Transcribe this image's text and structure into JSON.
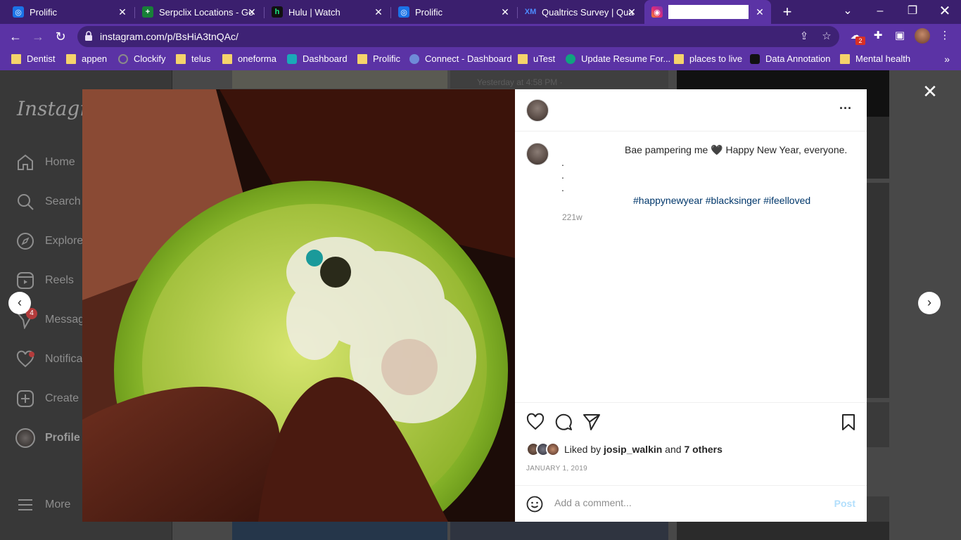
{
  "browser": {
    "tabs": [
      {
        "title": "Prolific",
        "icon": "prolific-icon",
        "color": "#1b73e8"
      },
      {
        "title": "Serpclix Locations - Go",
        "icon": "sheets-icon",
        "color": "#188038"
      },
      {
        "title": "Hulu | Watch",
        "icon": "hulu-icon",
        "color": "#111111"
      },
      {
        "title": "Prolific",
        "icon": "prolific-icon",
        "color": "#1b73e8"
      },
      {
        "title": "Qualtrics Survey | Qua",
        "icon": "qualtrics-icon",
        "color": "#2d6cdf"
      },
      {
        "title": "",
        "icon": "instagram-icon",
        "color": "#d62976"
      }
    ],
    "url": "instagram.com/p/BsHiA3tnQAc/",
    "bookmarks": [
      {
        "label": "Dentist",
        "type": "folder"
      },
      {
        "label": "appen",
        "type": "folder"
      },
      {
        "label": "Clockify",
        "type": "site"
      },
      {
        "label": "telus",
        "type": "folder"
      },
      {
        "label": "oneforma",
        "type": "folder"
      },
      {
        "label": "Dashboard",
        "type": "site"
      },
      {
        "label": "Prolific",
        "type": "folder"
      },
      {
        "label": "Connect - Dashboard",
        "type": "site"
      },
      {
        "label": "uTest",
        "type": "folder"
      },
      {
        "label": "Update Resume For...",
        "type": "site"
      },
      {
        "label": "places to live",
        "type": "folder"
      },
      {
        "label": "Data Annotation",
        "type": "site"
      },
      {
        "label": "Mental health",
        "type": "folder"
      }
    ],
    "extension_badge": "2"
  },
  "sidebar": {
    "logo": "Instagram",
    "items": [
      {
        "label": "Home",
        "icon": "home-icon"
      },
      {
        "label": "Search",
        "icon": "search-icon"
      },
      {
        "label": "Explore",
        "icon": "compass-icon"
      },
      {
        "label": "Reels",
        "icon": "reels-icon"
      },
      {
        "label": "Messages",
        "icon": "messages-icon",
        "badge": "4"
      },
      {
        "label": "Notifications",
        "icon": "heart-icon"
      },
      {
        "label": "Create",
        "icon": "plus-square-icon"
      },
      {
        "label": "Profile",
        "icon": "avatar"
      }
    ],
    "more": "More"
  },
  "background_post": {
    "timestamp": "Yesterday at 4:58 PM · "
  },
  "post": {
    "caption_main": "Bae pampering me 🖤 Happy New Year, everyone.",
    "caption_dots": [
      ".",
      ".",
      "."
    ],
    "hashtags": "#happynewyear #blacksinger #ifeelloved",
    "time_ago": "221w",
    "liked_by_prefix": "Liked by ",
    "liked_by_user": "josip_walkin",
    "liked_by_and": " and ",
    "liked_by_others": "7 others",
    "date": "JANUARY 1, 2019",
    "comment_placeholder": "Add a comment...",
    "post_button": "Post"
  }
}
